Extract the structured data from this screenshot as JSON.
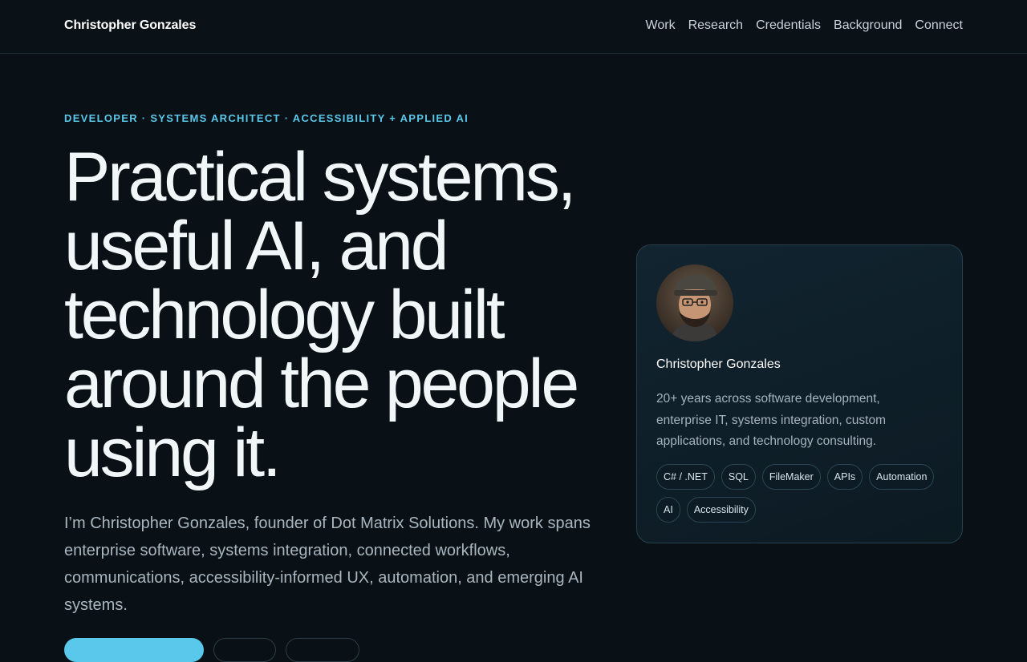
{
  "nav": {
    "brand": "Christopher Gonzales",
    "links": [
      "Work",
      "Research",
      "Credentials",
      "Background",
      "Connect"
    ]
  },
  "hero": {
    "eyebrow": "DEVELOPER · SYSTEMS ARCHITECT · ACCESSIBILITY + APPLIED AI",
    "headline": "Practical systems, useful AI, and technology built around the people using it.",
    "intro": "I’m Christopher Gonzales, founder of Dot Matrix Solutions. My work spans enterprise software, systems integration, connected workflows, communications, accessibility-informed UX, automation, and emerging AI systems."
  },
  "profile_card": {
    "name": "Christopher Gonzales",
    "description": "20+ years across software development, enterprise IT, systems integration, custom applications, and technology consulting.",
    "tags": [
      "C# / .NET",
      "SQL",
      "FileMaker",
      "APIs",
      "Automation",
      "AI",
      "Accessibility"
    ]
  },
  "colors": {
    "background": "#091116",
    "accent": "#5ac8ea",
    "card_border": "#26404d"
  }
}
